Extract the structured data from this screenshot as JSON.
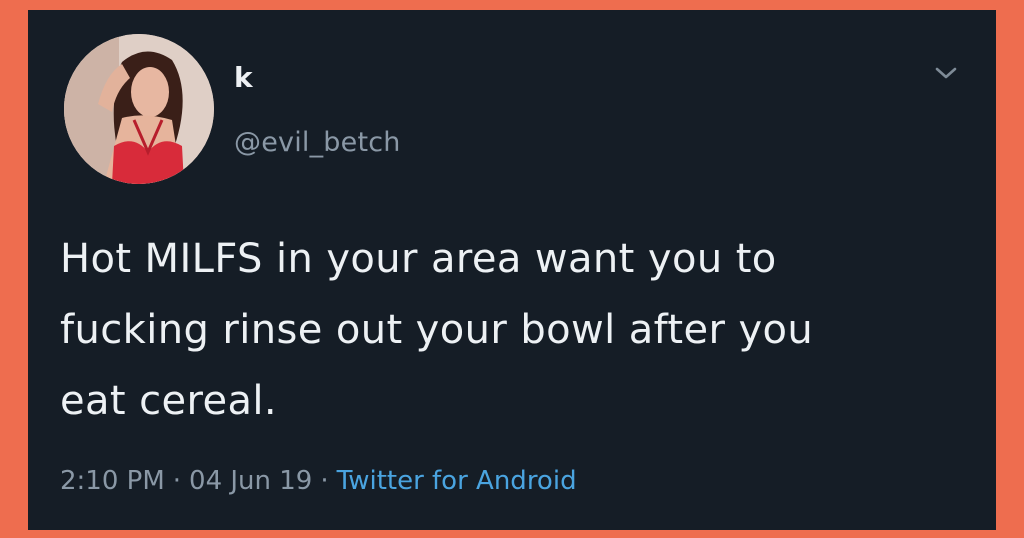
{
  "tweet": {
    "display_name": "k",
    "handle": "@evil_betch",
    "text_lines": [
      "Hot MILFS in your area want you to",
      "fucking rinse out your bowl after you",
      "eat cereal."
    ],
    "time": "2:10 PM",
    "separator": "·",
    "date": "04 Jun 19",
    "source": "Twitter for Android"
  },
  "icons": {
    "menu": "chevron-down-icon"
  },
  "colors": {
    "border": "#ee6d4f",
    "card_background": "#151d26",
    "text": "#edf1f4",
    "secondary_text": "#8a98a6",
    "link": "#4aa4e0"
  }
}
